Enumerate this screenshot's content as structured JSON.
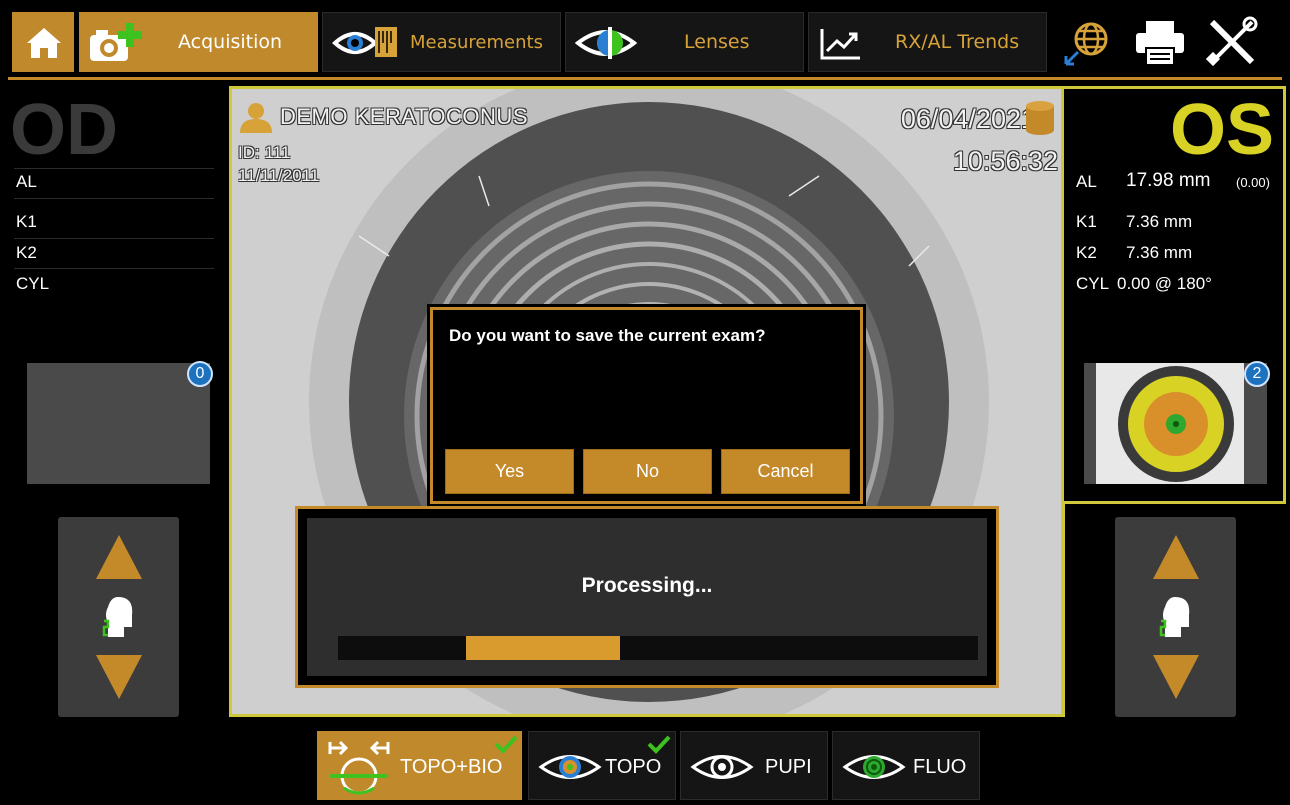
{
  "toolbar": {
    "acquisition_label": "Acquisition",
    "measurements_label": "Measurements",
    "lenses_label": "Lenses",
    "trends_label": "RX/AL Trends",
    "icons": [
      "home-icon",
      "camera-add-icon",
      "eye-measure-icon",
      "lens-eye-icon",
      "trend-chart-icon",
      "globe-icon",
      "printer-icon",
      "tools-icon"
    ]
  },
  "od": {
    "letter": "OD",
    "labels": [
      "AL",
      "K1",
      "K2",
      "CYL"
    ],
    "thumbnail_count": "0"
  },
  "os": {
    "letter": "OS",
    "al_label": "AL",
    "al_value": "17.98 mm",
    "al_delta": "(0.00)",
    "k1_label": "K1",
    "k1_value": "7.36 mm",
    "k2_label": "K2",
    "k2_value": "7.36 mm",
    "cyl_label": "CYL",
    "cyl_value": "0.00 @ 180°",
    "thumbnail_count": "2"
  },
  "patient": {
    "name": "DEMO KERATOCONUS",
    "id": "ID: 111",
    "dob": "11/11/2011",
    "exam_date": "06/04/2021",
    "exam_time": "10:56:32"
  },
  "dialog": {
    "question": "Do you want to save the current exam?",
    "yes": "Yes",
    "no": "No",
    "cancel": "Cancel"
  },
  "processing": {
    "text": "Processing...",
    "progress_start": 0.2,
    "progress_end": 0.44
  },
  "modes": [
    {
      "label": "TOPO+BIO",
      "checked": true,
      "active": true
    },
    {
      "label": "TOPO",
      "checked": true,
      "active": false
    },
    {
      "label": "PUPI",
      "checked": false,
      "active": false
    },
    {
      "label": "FLUO",
      "checked": false,
      "active": false
    }
  ],
  "colors": {
    "accent_gold": "#c48a2a",
    "os_yellow": "#d8d225",
    "od_gray": "#3a3a3a",
    "badge_blue": "#1c72bf",
    "check_green": "#3ec21f"
  }
}
